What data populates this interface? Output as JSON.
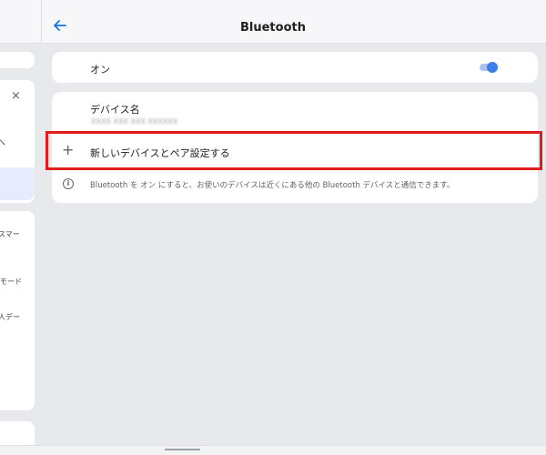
{
  "header": {
    "title": "Bluetooth",
    "back_icon": "arrow-back-icon"
  },
  "left_panel": {
    "close_glyph": "×",
    "glyph": "ヘ",
    "items": [
      "スマー",
      "モード",
      "人デー"
    ]
  },
  "bluetooth_toggle": {
    "label": "オン",
    "state": "on",
    "accent_color": "#3f7de6"
  },
  "device_name": {
    "label": "デバイス名",
    "value": "XXXX XXX XXX XXXXXX"
  },
  "pair_new": {
    "label": "新しいデバイスとペア設定する",
    "icon": "plus-icon",
    "highlight_color": "#e01c1c"
  },
  "info": {
    "icon": "info-icon",
    "text": "Bluetooth を オン にすると、お使いのデバイスは近くにある他の Bluetooth デバイスと通信できます。"
  }
}
